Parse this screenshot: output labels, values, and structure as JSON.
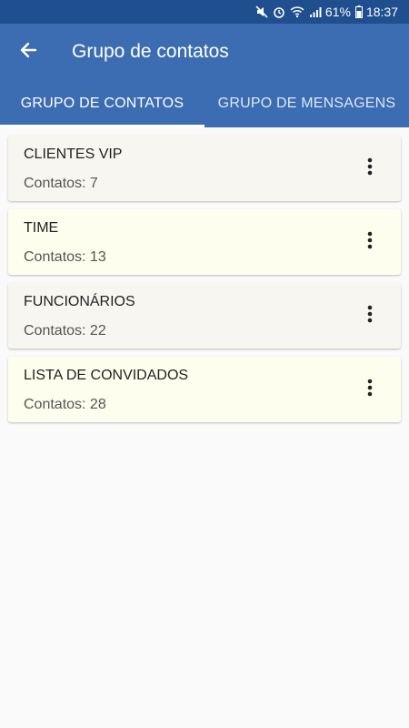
{
  "status_bar": {
    "battery": "61%",
    "time": "18:37"
  },
  "app_bar": {
    "title": "Grupo de contatos"
  },
  "tabs": [
    {
      "label": "GRUPO DE CONTATOS",
      "active": true
    },
    {
      "label": "GRUPO DE MENSAGENS",
      "active": false
    }
  ],
  "groups": [
    {
      "name": "CLIENTES VIP",
      "count": "Contatos: 7",
      "bg": "#f7f6f1"
    },
    {
      "name": "TIME",
      "count": "Contatos: 13",
      "bg": "#fefeee"
    },
    {
      "name": "FUNCIONÁRIOS",
      "count": "Contatos: 22",
      "bg": "#f7f6f1"
    },
    {
      "name": "LISTA DE CONVIDADOS",
      "count": "Contatos: 28",
      "bg": "#fefeee"
    }
  ],
  "colors": {
    "status_bar": "#1f4f8e",
    "primary": "#3c6cb1",
    "background": "#fafafa"
  },
  "icons": {
    "back": "arrow-back-icon",
    "menu": "more-vert-icon"
  }
}
